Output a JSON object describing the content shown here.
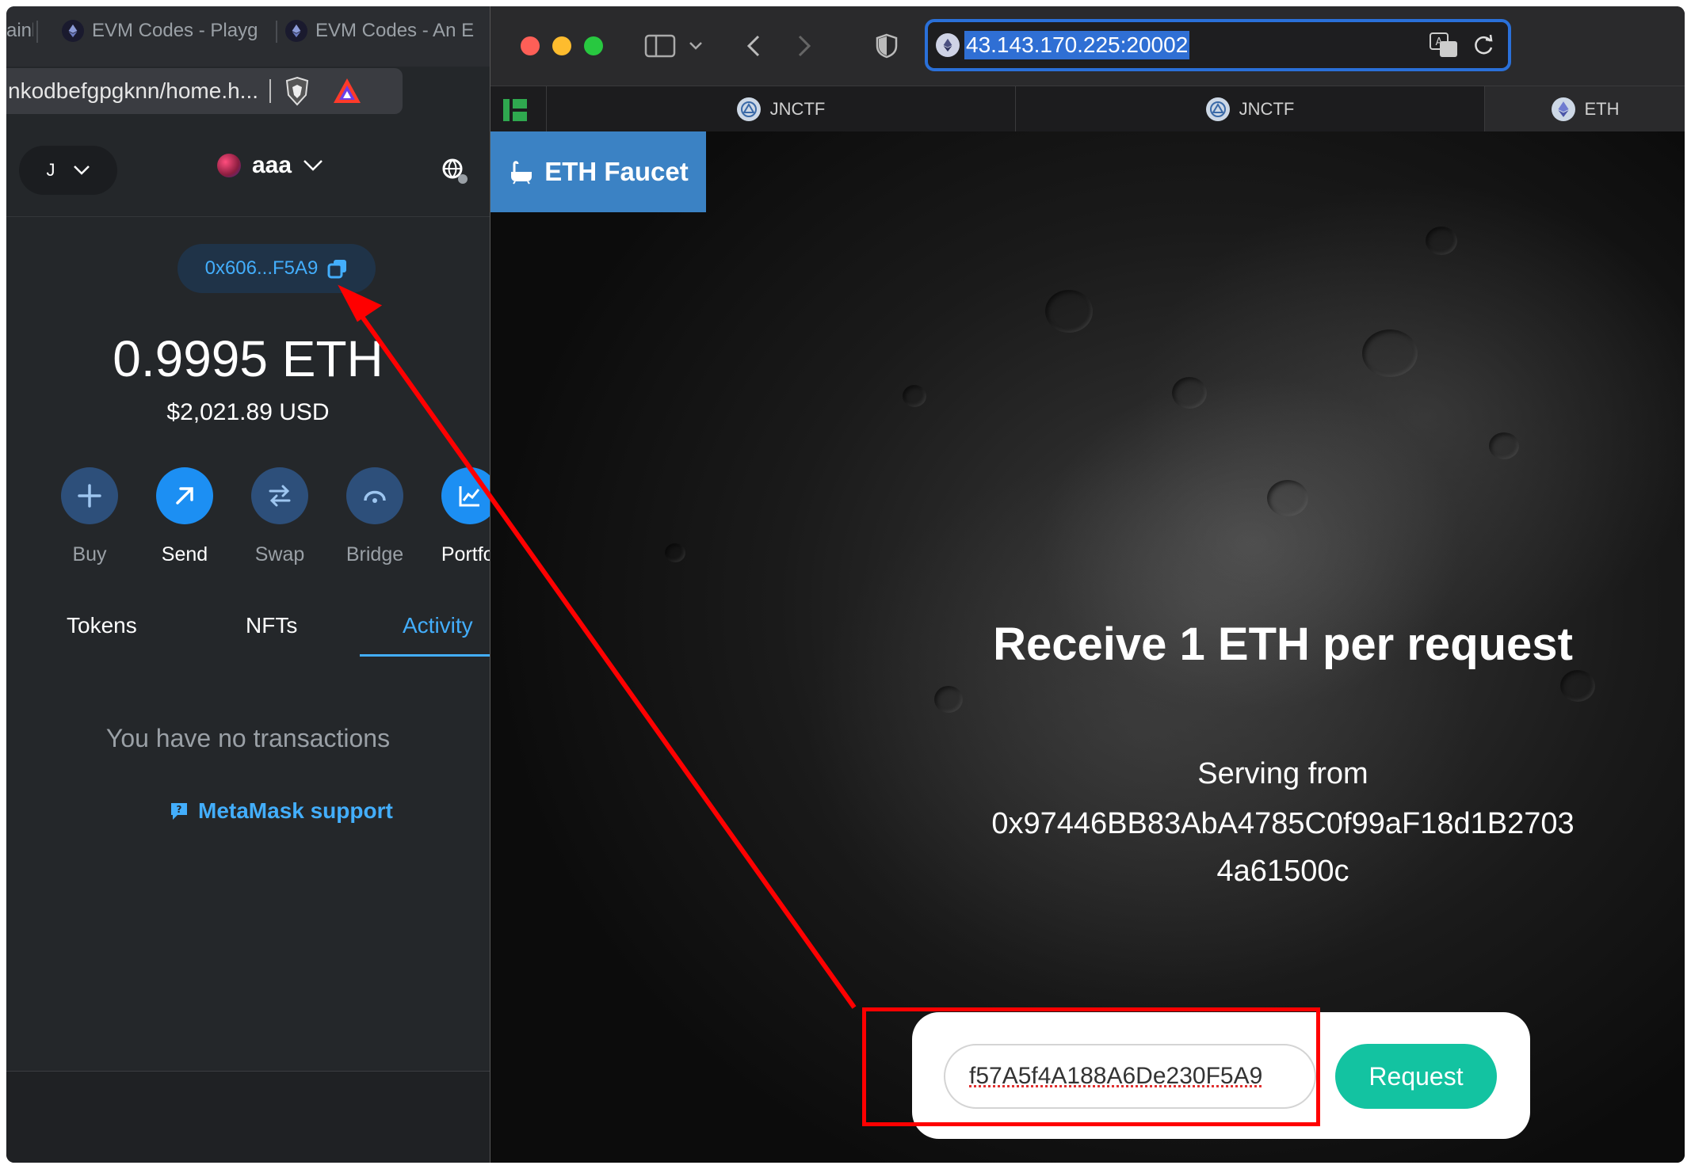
{
  "left_browser": {
    "tabs": [
      {
        "label": "ainl"
      },
      {
        "label": "EVM Codes - Playg"
      },
      {
        "label": "EVM Codes - An E"
      }
    ],
    "address": "nkodbefgpgknn/home.h..."
  },
  "metamask": {
    "account_initial": "J",
    "network_name": "aaa",
    "address_short": "0x606...F5A9",
    "balance": "0.9995 ETH",
    "fiat_balance": "$2,021.89 USD",
    "actions": [
      {
        "label": "Buy"
      },
      {
        "label": "Send"
      },
      {
        "label": "Swap"
      },
      {
        "label": "Bridge"
      },
      {
        "label": "Portfol"
      }
    ],
    "tabs": [
      {
        "label": "Tokens"
      },
      {
        "label": "NFTs"
      },
      {
        "label": "Activity"
      }
    ],
    "empty_message": "You have no transactions",
    "support_link": "MetaMask support"
  },
  "safari": {
    "url": "43.143.170.225:20002",
    "tabs": [
      {
        "label": "JNCTF"
      },
      {
        "label": "JNCTF"
      },
      {
        "label": "ETH"
      }
    ]
  },
  "faucet": {
    "nav_label": "ETH Faucet",
    "headline": "Receive 1 ETH per request",
    "serving_label": "Serving from",
    "serving_address_line1": "0x97446BB83AbA4785C0f99aF18d1B2703",
    "serving_address_line2": "4a61500c",
    "input_value": "f57A5f4A188A6De230F5A9",
    "request_label": "Request"
  },
  "colors": {
    "metamask_blue": "#43aefc",
    "faucet_button": "#3b82c4",
    "request_button": "#13c3a1",
    "annotation_red": "#ff0000"
  }
}
